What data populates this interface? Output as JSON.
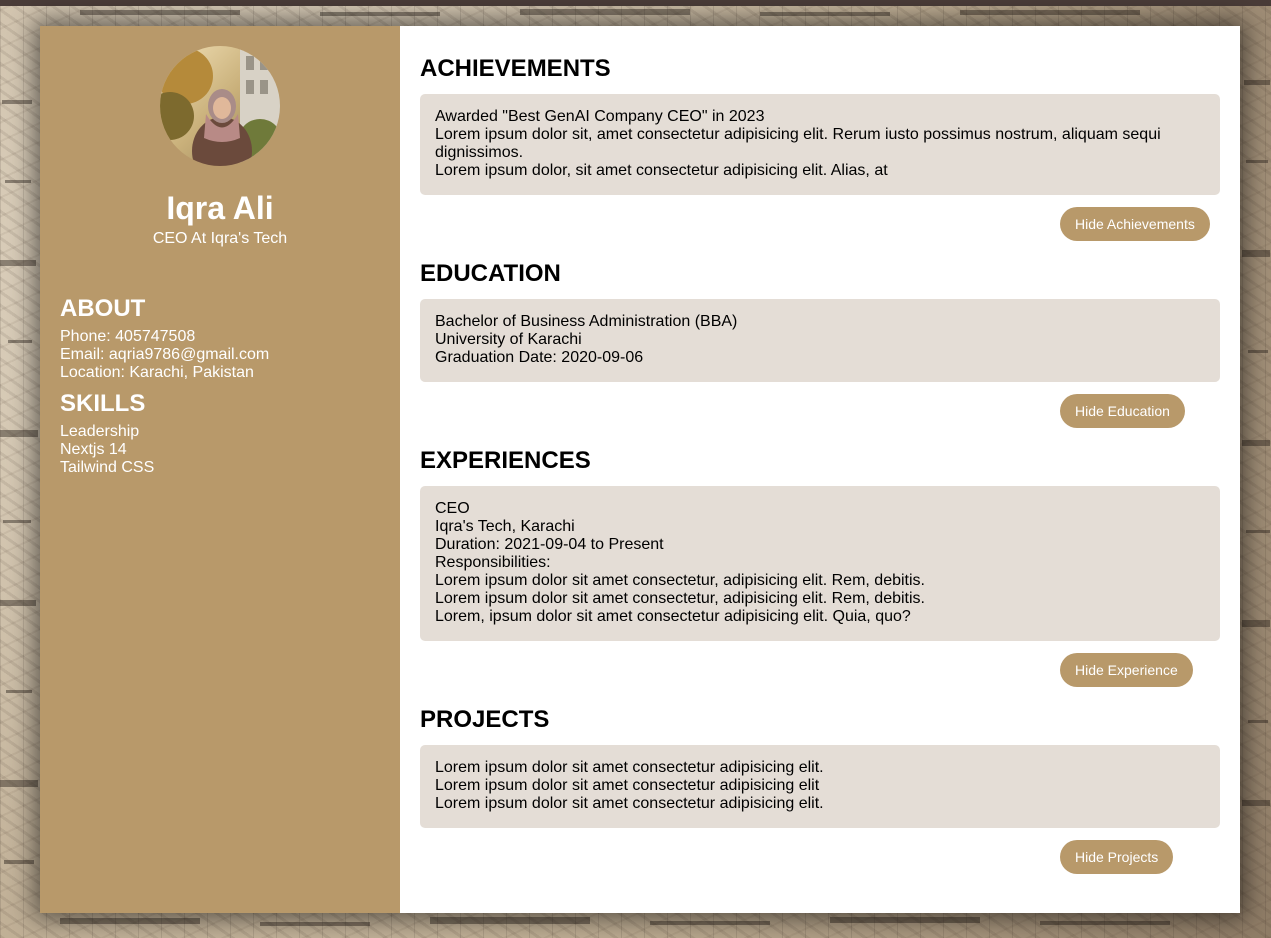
{
  "profile": {
    "name": "Iqra Ali",
    "title": "CEO At Iqra's Tech"
  },
  "about": {
    "heading": "ABOUT",
    "phone": "Phone: 405747508",
    "email": "Email: aqria9786@gmail.com",
    "location": "Location: Karachi, Pakistan"
  },
  "skills": {
    "heading": "SKILLS",
    "items": [
      "Leadership",
      "Nextjs 14",
      "Tailwind CSS"
    ]
  },
  "achievements": {
    "heading": "ACHIEVEMENTS",
    "lines": [
      "Awarded \"Best GenAI Company CEO\" in 2023",
      "Lorem ipsum dolor sit, amet consectetur adipisicing elit. Rerum iusto possimus nostrum, aliquam sequi dignissimos.",
      "Lorem ipsum dolor, sit amet consectetur adipisicing elit. Alias, at"
    ],
    "button": "Hide Achievements"
  },
  "education": {
    "heading": "EDUCATION",
    "lines": [
      "Bachelor of Business Administration (BBA)",
      "University of Karachi",
      "Graduation Date: 2020-09-06"
    ],
    "button": "Hide Education"
  },
  "experiences": {
    "heading": "EXPERIENCES",
    "lines": [
      "CEO",
      "Iqra's Tech, Karachi",
      "Duration: 2021-09-04 to Present",
      "Responsibilities:",
      "Lorem ipsum dolor sit amet consectetur, adipisicing elit. Rem, debitis.",
      "Lorem ipsum dolor sit amet consectetur, adipisicing elit. Rem, debitis.",
      "Lorem, ipsum dolor sit amet consectetur adipisicing elit. Quia, quo?"
    ],
    "button": "Hide Experience"
  },
  "projects": {
    "heading": "PROJECTS",
    "lines": [
      "Lorem ipsum dolor sit amet consectetur adipisicing elit.",
      "Lorem ipsum dolor sit amet consectetur adipisicing elit",
      "Lorem ipsum dolor sit amet consectetur adipisicing elit."
    ],
    "button": "Hide Projects"
  },
  "colors": {
    "accent": "#b8996a",
    "card_bg": "#e4ddd6",
    "main_bg": "#ffffff",
    "page_bg": "#cdbfa9"
  },
  "icons": {
    "avatar": "profile-photo"
  }
}
